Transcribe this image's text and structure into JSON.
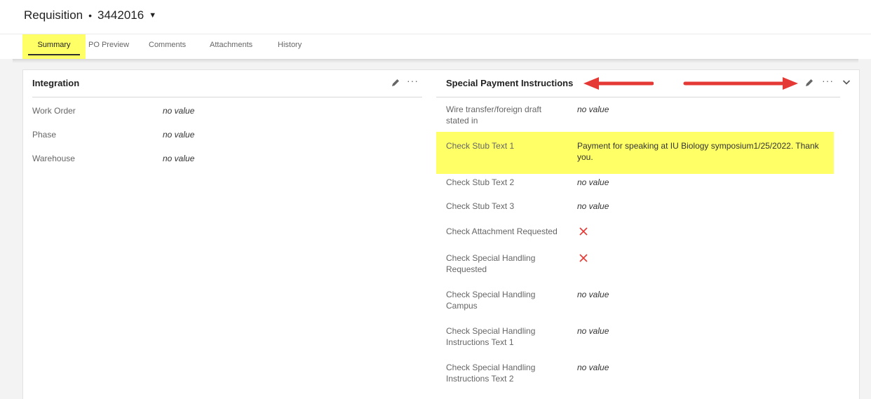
{
  "header": {
    "title": "Requisition",
    "number": "3442016"
  },
  "tabs": [
    {
      "label": "Summary"
    },
    {
      "label": "PO Preview"
    },
    {
      "label": "Comments"
    },
    {
      "label": "Attachments"
    },
    {
      "label": "History"
    }
  ],
  "integration": {
    "title": "Integration",
    "rows": [
      {
        "label": "Work Order",
        "value": "no value"
      },
      {
        "label": "Phase",
        "value": "no value"
      },
      {
        "label": "Warehouse",
        "value": "no value"
      }
    ]
  },
  "payment": {
    "title": "Special Payment Instructions",
    "rows": [
      {
        "label": "Wire transfer/foreign draft stated in",
        "value": "no value"
      },
      {
        "label": "Check Stub Text 1",
        "value": "Payment for speaking at IU Biology symposium1/25/2022. Thank you."
      },
      {
        "label": "Check Stub Text 2",
        "value": "no value"
      },
      {
        "label": "Check Stub Text 3",
        "value": "no value"
      },
      {
        "label": "Check Attachment Requested",
        "value": ""
      },
      {
        "label": "Check Special Handling Requested",
        "value": ""
      },
      {
        "label": "Check Special Handling Campus",
        "value": "no value"
      },
      {
        "label": "Check Special Handling Instructions Text 1",
        "value": "no value"
      },
      {
        "label": "Check Special Handling Instructions Text 2",
        "value": "no value"
      }
    ]
  },
  "colors": {
    "highlight": "#ffff66",
    "arrow": "#e53935",
    "x_mark": "#e53935"
  }
}
